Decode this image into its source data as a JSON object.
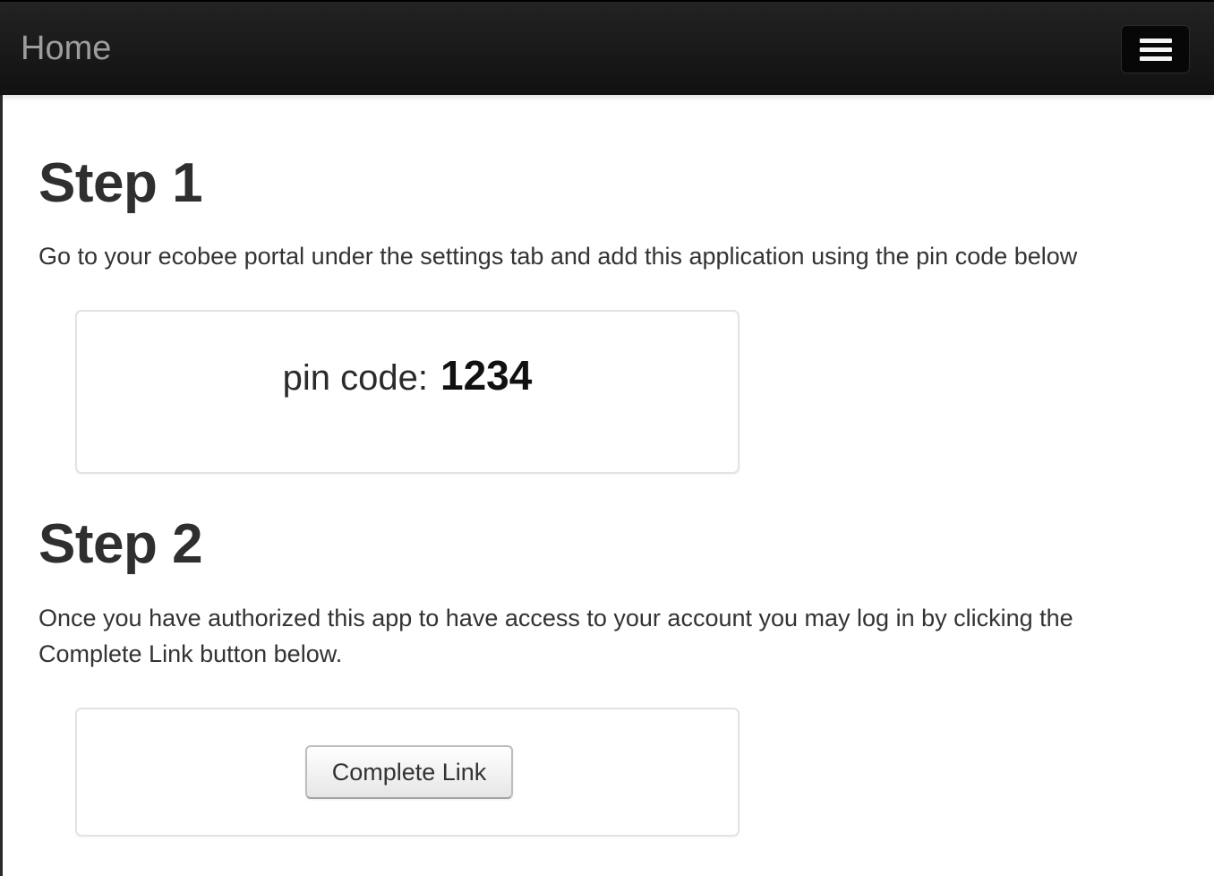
{
  "navbar": {
    "brand": "Home",
    "menu_icon": "hamburger-menu-icon"
  },
  "step1": {
    "title": "Step 1",
    "instructions": "Go to your ecobee portal under the settings tab and add this application using the pin code below",
    "pin_label": "pin code:",
    "pin_value": "1234"
  },
  "step2": {
    "title": "Step 2",
    "instructions": "Once you have authorized this app to have access to your account you may log in by clicking the Complete Link button below.",
    "button_label": "Complete Link"
  },
  "colors": {
    "navbar_bg": "#111111",
    "brand_text": "#9d9d9d",
    "body_text": "#333333",
    "panel_border": "#e3e3e3"
  }
}
